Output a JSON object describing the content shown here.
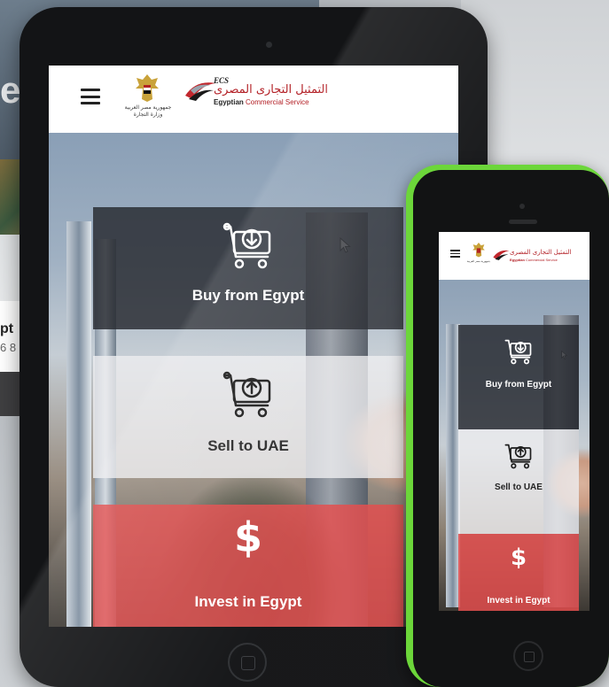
{
  "background_site": {
    "big_text": "es",
    "card_title": "pt",
    "card_sub": "6 8"
  },
  "site": {
    "emblem_caption_line1": "جمهورية مصر العربية",
    "emblem_caption_line2": "وزارة التجارة",
    "logo_short": "ECS",
    "logo_arabic": "التمثيل التجارى المصرى",
    "logo_english_bold": "Egyptian",
    "logo_english_rest": " Commercial Service"
  },
  "tiles": {
    "buy": {
      "label": "Buy from Egypt",
      "icon": "cart-download-icon"
    },
    "sell": {
      "label": "Sell to UAE",
      "icon": "cart-upload-icon"
    },
    "invest": {
      "label": "Invest in Egypt",
      "icon": "dollar-icon",
      "glyph": "$"
    }
  },
  "colors": {
    "invest_red": "#e24c4c",
    "buy_dark": "#26282e",
    "brand_red": "#b32026",
    "phone_green": "#6cd63a"
  }
}
